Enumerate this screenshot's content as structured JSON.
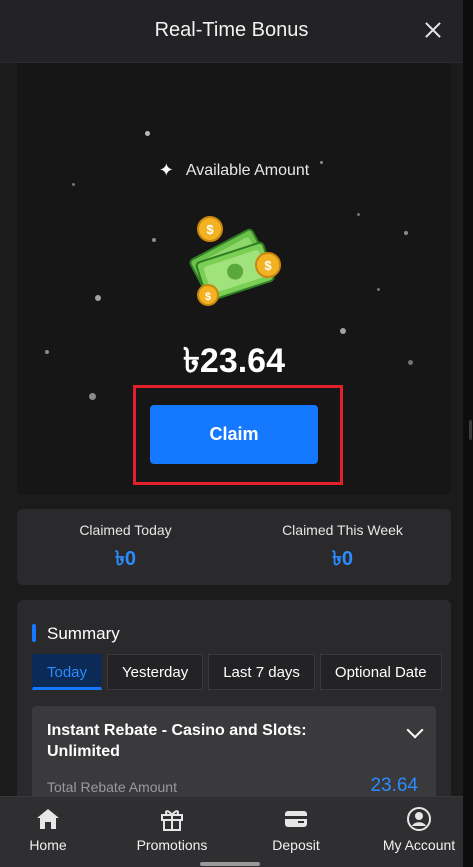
{
  "header": {
    "title": "Real-Time Bonus"
  },
  "hero": {
    "available_label": "Available Amount",
    "amount": "৳23.64",
    "claim_label": "Claim"
  },
  "claimed": {
    "today_label": "Claimed Today",
    "today_value": "৳0",
    "week_label": "Claimed This Week",
    "week_value": "৳0"
  },
  "summary": {
    "title": "Summary",
    "tabs": [
      "Today",
      "Yesterday",
      "Last 7 days",
      "Optional Date"
    ],
    "active_tab": "Today",
    "rebate": {
      "title": "Instant Rebate - Casino and Slots: Unlimited",
      "total_label": "Total Rebate Amount",
      "total_value": "23.64"
    }
  },
  "nav": {
    "items": [
      {
        "label": "Home",
        "icon": "home-icon"
      },
      {
        "label": "Promotions",
        "icon": "gift-icon"
      },
      {
        "label": "Deposit",
        "icon": "wallet-icon"
      },
      {
        "label": "My Account",
        "icon": "user-icon"
      }
    ]
  },
  "colors": {
    "accent": "#1479ff",
    "highlight_box": "#e3202a",
    "value_blue": "#2b8bff",
    "background": "#1b1b1c"
  }
}
